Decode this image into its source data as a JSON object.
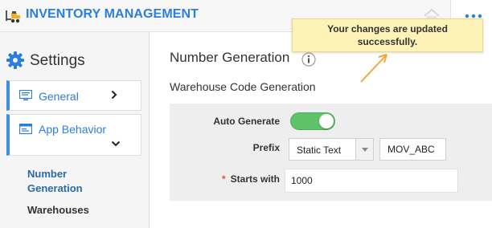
{
  "header": {
    "title": "INVENTORY MANAGEMENT",
    "logo_icon": "forklift-icon",
    "more_icon": "more-dots-icon",
    "accent_color": "#2a7de1"
  },
  "sidebar": {
    "heading": "Settings",
    "items": [
      {
        "label": "General",
        "icon": "monitor-icon",
        "state": "collapsed"
      },
      {
        "label": "App Behavior",
        "icon": "window-icon",
        "state": "expanded"
      }
    ],
    "sub_items": [
      {
        "label": "Number Generation",
        "active": true
      },
      {
        "label": "Warehouses",
        "active": false
      }
    ]
  },
  "main": {
    "title": "Number Generation",
    "section_title": "Warehouse Code Generation",
    "form": {
      "auto_generate": {
        "label": "Auto Generate",
        "enabled": true
      },
      "prefix": {
        "label": "Prefix",
        "type_value": "Static Text",
        "value": "MOV_ABC"
      },
      "starts_with": {
        "label": "Starts with",
        "required_mark": "*",
        "value": "1000"
      }
    }
  },
  "toast": {
    "message": "Your changes are updated successfully.",
    "background": "#fdf3b7"
  },
  "colors": {
    "toggle_on": "#5dc26a",
    "nav_border": "#3d8fe0",
    "arrow": "#f0a63a"
  }
}
